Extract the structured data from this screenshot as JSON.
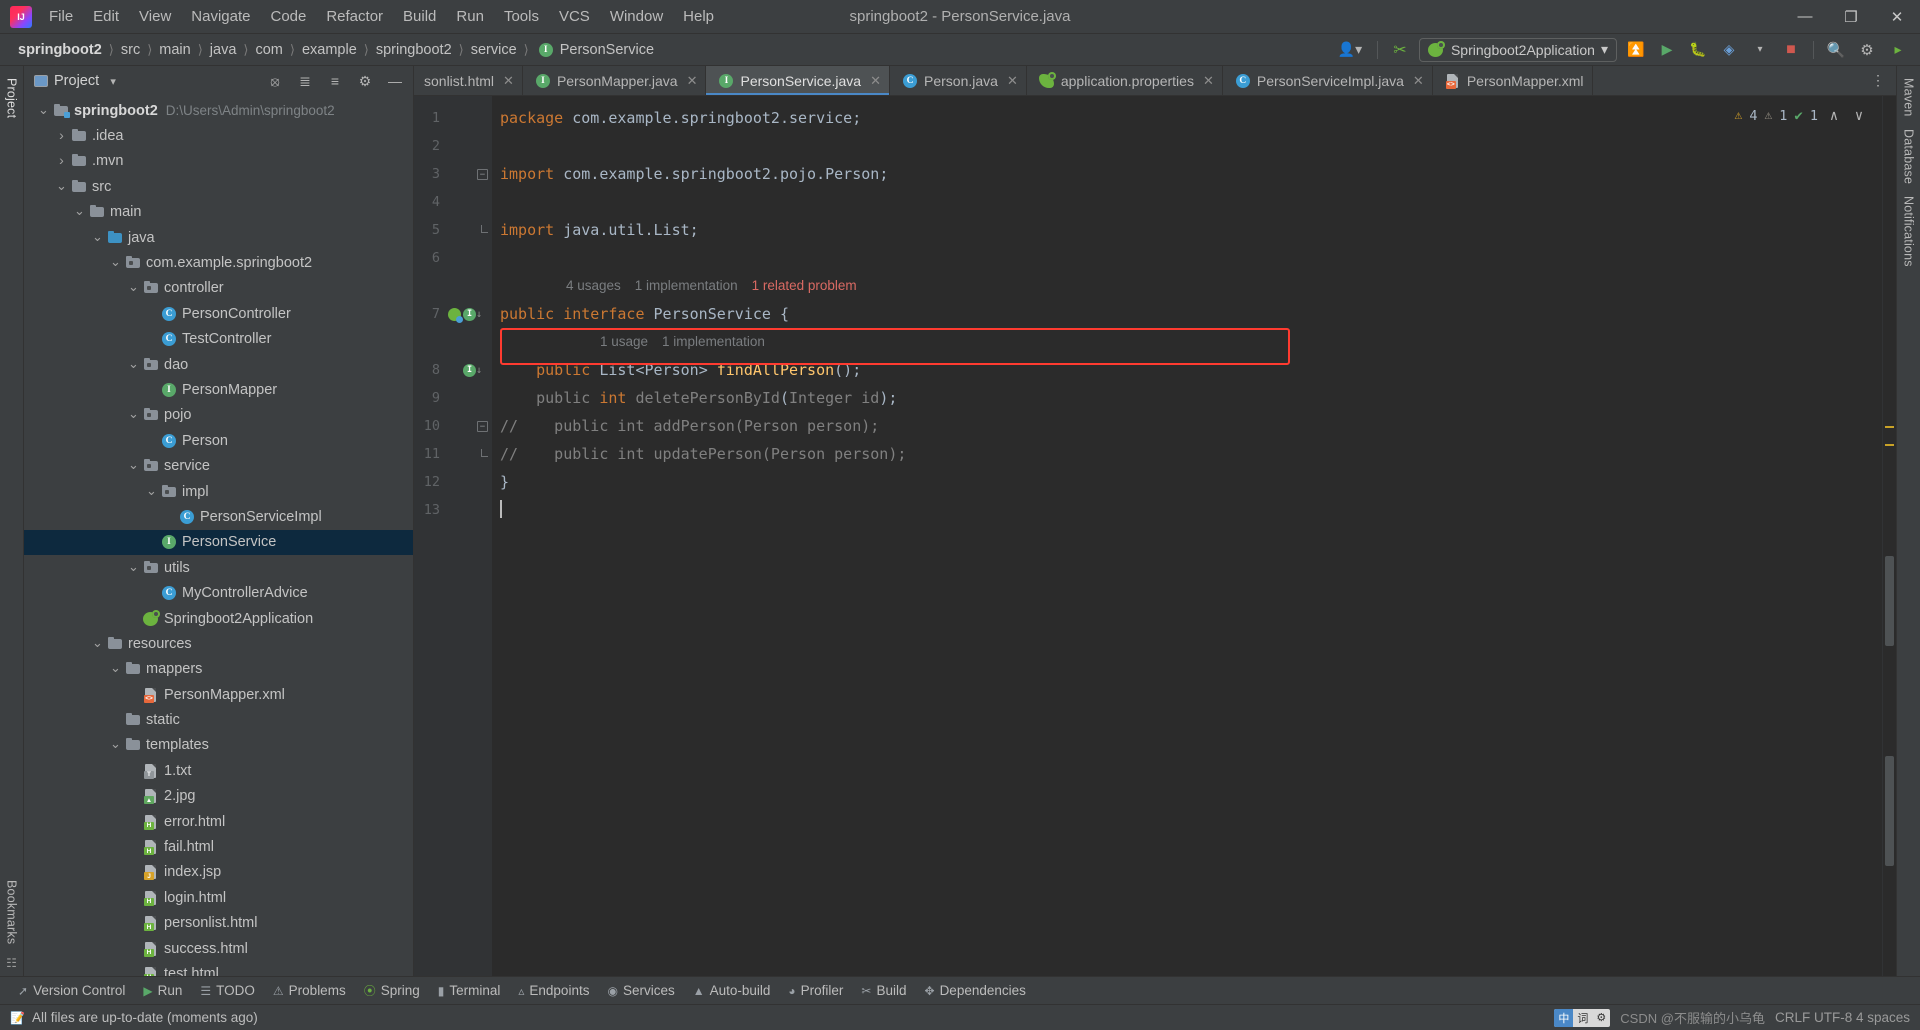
{
  "window": {
    "title": "springboot2 - PersonService.java",
    "logo_icon": "intellij-idea-logo",
    "minimize_label": "—",
    "maximize_label": "❐",
    "close_label": "✕"
  },
  "menubar": {
    "items": [
      {
        "label": "File"
      },
      {
        "label": "Edit"
      },
      {
        "label": "View"
      },
      {
        "label": "Navigate"
      },
      {
        "label": "Code"
      },
      {
        "label": "Refactor"
      },
      {
        "label": "Build"
      },
      {
        "label": "Run"
      },
      {
        "label": "Tools"
      },
      {
        "label": "VCS"
      },
      {
        "label": "Window"
      },
      {
        "label": "Help"
      }
    ]
  },
  "navbar": {
    "crumbs": [
      {
        "label": "springboot2",
        "bold": true
      },
      {
        "label": "src",
        "bold": false
      },
      {
        "label": "main",
        "bold": false
      },
      {
        "label": "java",
        "bold": false
      },
      {
        "label": "com",
        "bold": false
      },
      {
        "label": "example",
        "bold": false
      },
      {
        "label": "springboot2",
        "bold": false
      },
      {
        "label": "service",
        "bold": false
      },
      {
        "label": "PersonService",
        "bold": false,
        "icon": "interface-icon"
      }
    ],
    "separator": "〉",
    "account_icon": "user-account-icon",
    "hammer_icon": "build-hammer-icon",
    "run_config": "Springboot2Application",
    "run_config_icon": "spring-boot-icon",
    "run_config_chevron": "▾",
    "buttons": [
      {
        "name": "add-configuration-icon",
        "glyph": "⤓"
      },
      {
        "name": "run-icon",
        "glyph": "▶"
      },
      {
        "name": "debug-icon",
        "glyph": "☲"
      },
      {
        "name": "run-with-coverage-icon",
        "glyph": "◔"
      },
      {
        "name": "more-run-options-icon",
        "glyph": "▾"
      },
      {
        "name": "stop-icon",
        "glyph": "■"
      },
      {
        "name": "search-everywhere-icon",
        "glyph": "⚲"
      },
      {
        "name": "settings-gear-icon",
        "glyph": "⚙"
      },
      {
        "name": "updates-icon",
        "glyph": "▶"
      }
    ]
  },
  "left_rail": {
    "labels": [
      "Project",
      "Bookmarks",
      "Structure"
    ]
  },
  "right_rail": {
    "labels": [
      "Maven",
      "Database",
      "Notifications"
    ]
  },
  "project_panel": {
    "title": "Project",
    "dropdown_glyph": "▾",
    "toolbar_icons": [
      {
        "name": "select-opened-file-icon",
        "glyph": "⊕"
      },
      {
        "name": "expand-all-icon",
        "glyph": "≡"
      },
      {
        "name": "collapse-all-icon",
        "glyph": "≣"
      },
      {
        "name": "panel-settings-icon",
        "glyph": "⚙"
      },
      {
        "name": "hide-panel-icon",
        "glyph": "—"
      }
    ],
    "tree": [
      {
        "label": "springboot2",
        "sub": "D:\\Users\\Admin\\springboot2",
        "depth": 0,
        "arrow": "down",
        "icon": "module-folder-icon",
        "bold": true,
        "selected": false
      },
      {
        "label": ".idea",
        "depth": 1,
        "arrow": "right",
        "icon": "folder-icon",
        "selected": false
      },
      {
        "label": ".mvn",
        "depth": 1,
        "arrow": "right",
        "icon": "folder-icon",
        "selected": false
      },
      {
        "label": "src",
        "depth": 1,
        "arrow": "down",
        "icon": "folder-icon",
        "selected": false
      },
      {
        "label": "main",
        "depth": 2,
        "arrow": "down",
        "icon": "folder-icon",
        "selected": false
      },
      {
        "label": "java",
        "depth": 3,
        "arrow": "down",
        "icon": "source-folder-icon",
        "selected": false
      },
      {
        "label": "com.example.springboot2",
        "depth": 4,
        "arrow": "down",
        "icon": "package-icon",
        "selected": false
      },
      {
        "label": "controller",
        "depth": 5,
        "arrow": "down",
        "icon": "package-icon",
        "selected": false
      },
      {
        "label": "PersonController",
        "depth": 6,
        "arrow": "none",
        "icon": "class-icon",
        "selected": false
      },
      {
        "label": "TestController",
        "depth": 6,
        "arrow": "none",
        "icon": "class-icon",
        "selected": false
      },
      {
        "label": "dao",
        "depth": 5,
        "arrow": "down",
        "icon": "package-icon",
        "selected": false
      },
      {
        "label": "PersonMapper",
        "depth": 6,
        "arrow": "none",
        "icon": "interface-icon",
        "selected": false
      },
      {
        "label": "pojo",
        "depth": 5,
        "arrow": "down",
        "icon": "package-icon",
        "selected": false
      },
      {
        "label": "Person",
        "depth": 6,
        "arrow": "none",
        "icon": "class-icon",
        "selected": false
      },
      {
        "label": "service",
        "depth": 5,
        "arrow": "down",
        "icon": "package-icon",
        "selected": false
      },
      {
        "label": "impl",
        "depth": 6,
        "arrow": "down",
        "icon": "package-icon",
        "selected": false
      },
      {
        "label": "PersonServiceImpl",
        "depth": 7,
        "arrow": "none",
        "icon": "class-icon",
        "selected": false
      },
      {
        "label": "PersonService",
        "depth": 6,
        "arrow": "none",
        "icon": "interface-icon",
        "selected": true
      },
      {
        "label": "utils",
        "depth": 5,
        "arrow": "down",
        "icon": "package-icon",
        "selected": false
      },
      {
        "label": "MyControllerAdvice",
        "depth": 6,
        "arrow": "none",
        "icon": "class-icon",
        "selected": false
      },
      {
        "label": "Springboot2Application",
        "depth": 5,
        "arrow": "none",
        "icon": "spring-boot-icon",
        "selected": false
      },
      {
        "label": "resources",
        "depth": 3,
        "arrow": "down",
        "icon": "resources-folder-icon",
        "selected": false
      },
      {
        "label": "mappers",
        "depth": 4,
        "arrow": "down",
        "icon": "folder-icon",
        "selected": false
      },
      {
        "label": "PersonMapper.xml",
        "depth": 5,
        "arrow": "none",
        "icon": "xml-file-icon",
        "selected": false
      },
      {
        "label": "static",
        "depth": 4,
        "arrow": "none",
        "icon": "folder-icon",
        "selected": false
      },
      {
        "label": "templates",
        "depth": 4,
        "arrow": "down",
        "icon": "folder-icon",
        "selected": false
      },
      {
        "label": "1.txt",
        "depth": 5,
        "arrow": "none",
        "icon": "text-file-icon",
        "selected": false
      },
      {
        "label": "2.jpg",
        "depth": 5,
        "arrow": "none",
        "icon": "image-file-icon",
        "selected": false
      },
      {
        "label": "error.html",
        "depth": 5,
        "arrow": "none",
        "icon": "html-file-icon",
        "selected": false
      },
      {
        "label": "fail.html",
        "depth": 5,
        "arrow": "none",
        "icon": "html-file-icon",
        "selected": false
      },
      {
        "label": "index.jsp",
        "depth": 5,
        "arrow": "none",
        "icon": "jsp-file-icon",
        "selected": false
      },
      {
        "label": "login.html",
        "depth": 5,
        "arrow": "none",
        "icon": "html-file-icon",
        "selected": false
      },
      {
        "label": "personlist.html",
        "depth": 5,
        "arrow": "none",
        "icon": "html-file-icon",
        "selected": false
      },
      {
        "label": "success.html",
        "depth": 5,
        "arrow": "none",
        "icon": "html-file-icon",
        "selected": false
      },
      {
        "label": "test.html",
        "depth": 5,
        "arrow": "none",
        "icon": "html-file-icon",
        "selected": false
      }
    ]
  },
  "editor_tabs": {
    "close_glyph": "✕",
    "tabs": [
      {
        "label": "sonlist.html",
        "icon": "html-file-icon",
        "active": false,
        "truncated": true
      },
      {
        "label": "PersonMapper.java",
        "icon": "interface-icon",
        "active": false
      },
      {
        "label": "PersonService.java",
        "icon": "interface-icon",
        "active": true
      },
      {
        "label": "Person.java",
        "icon": "class-icon",
        "active": false
      },
      {
        "label": "application.properties",
        "icon": "spring-properties-icon",
        "active": false
      },
      {
        "label": "PersonServiceImpl.java",
        "icon": "class-icon",
        "active": false
      },
      {
        "label": "PersonMapper.xml",
        "icon": "xml-file-icon",
        "active": false
      }
    ],
    "overflow_glyph": "⋮"
  },
  "editor": {
    "inspection": {
      "warnings_icon": "warning-triangle-icon",
      "warnings_count": "4",
      "weak_warnings_icon": "weak-warning-triangle-icon",
      "weak_warnings_count": "1",
      "typos_icon": "checkmark-icon",
      "typos_count": "1",
      "prev_glyph": "∧",
      "next_glyph": "∨"
    },
    "line_numbers": [
      "1",
      "2",
      "3",
      "4",
      "5",
      "6",
      "7",
      "8",
      "9",
      "10",
      "11",
      "12",
      "13"
    ],
    "lines": [
      {
        "n": 1,
        "type": "code",
        "text": "package com.example.springboot2.service;"
      },
      {
        "n": 2,
        "type": "blank",
        "text": ""
      },
      {
        "n": 3,
        "type": "code",
        "text": "import com.example.springboot2.pojo.Person;"
      },
      {
        "n": 4,
        "type": "blank",
        "text": ""
      },
      {
        "n": 5,
        "type": "code",
        "text": "import java.util.List;"
      },
      {
        "n": 6,
        "type": "blank",
        "text": ""
      },
      {
        "n": 7,
        "type": "code",
        "text": "public interface PersonService {"
      },
      {
        "n": 8,
        "type": "code",
        "text": "    public List<Person> findAllPerson();"
      },
      {
        "n": 9,
        "type": "code",
        "text": "    public int deletePersonById(Integer id);"
      },
      {
        "n": 10,
        "type": "comment",
        "text": "//    public int addPerson(Person person);"
      },
      {
        "n": 11,
        "type": "comment",
        "text": "//    public int updatePerson(Person person);"
      },
      {
        "n": 12,
        "type": "code",
        "text": "}"
      },
      {
        "n": 13,
        "type": "blank",
        "text": ""
      }
    ],
    "hints": {
      "interface_usages": "4 usages",
      "interface_implementations": "1 implementation",
      "interface_problem": "1 related problem",
      "method_usages": "1 usage",
      "method_implementations": "1 implementation"
    },
    "highlight_note": "red-annotation-box-around-line-9"
  },
  "bottom_toolbar": {
    "items": [
      {
        "label": "Version Control",
        "icon": "branch-icon"
      },
      {
        "label": "Run",
        "icon": "run-icon"
      },
      {
        "label": "TODO",
        "icon": "todo-list-icon"
      },
      {
        "label": "Problems",
        "icon": "problems-icon"
      },
      {
        "label": "Spring",
        "icon": "spring-leaf-icon"
      },
      {
        "label": "Terminal",
        "icon": "terminal-icon"
      },
      {
        "label": "Endpoints",
        "icon": "endpoints-icon"
      },
      {
        "label": "Services",
        "icon": "services-icon"
      },
      {
        "label": "Auto-build",
        "icon": "auto-build-icon"
      },
      {
        "label": "Profiler",
        "icon": "profiler-icon"
      },
      {
        "label": "Build",
        "icon": "build-hammer-icon"
      },
      {
        "label": "Dependencies",
        "icon": "dependencies-icon"
      }
    ]
  },
  "statusbar": {
    "icon": "sync-status-icon",
    "message": "All files are up-to-date (moments ago)",
    "ime": {
      "cells": [
        "中",
        "词",
        "⚙"
      ]
    },
    "watermark": "CSDN @不服输的小乌龟",
    "encoding": "CRLF  UTF-8  4 spaces"
  },
  "colors": {
    "accent_blue": "#4a88c7",
    "selection": "#0d293e",
    "panel_bg": "#3c3f41",
    "editor_bg": "#2b2b2b",
    "highlight_red": "#ff3b30",
    "keyword_orange": "#cc7832",
    "method_yellow": "#ffc66d",
    "comment_gray": "#808080",
    "green_badge": "#59a869"
  }
}
